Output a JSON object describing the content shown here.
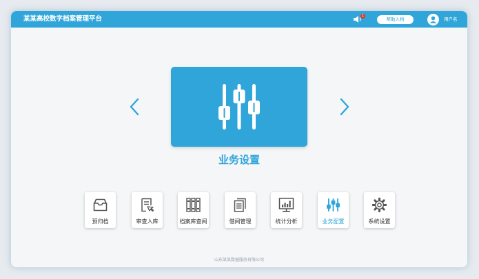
{
  "header": {
    "title": "某某高校数字档案管理平台",
    "notification_count": "1",
    "help_label": "帮助入档",
    "username": "用户名"
  },
  "feature": {
    "title": "业务设置",
    "icon": "sliders-icon"
  },
  "nav": [
    {
      "label": "预归档",
      "icon": "inbox-icon"
    },
    {
      "label": "审查入库",
      "icon": "document-review-icon"
    },
    {
      "label": "档案库查阅",
      "icon": "binders-icon"
    },
    {
      "label": "借阅管理",
      "icon": "documents-icon"
    },
    {
      "label": "统计分析",
      "icon": "bar-chart-icon"
    },
    {
      "label": "业务配置",
      "icon": "sliders-icon",
      "active": true
    },
    {
      "label": "系统设置",
      "icon": "gear-icon"
    }
  ],
  "footer": {
    "copyright": "山东某某数据服务有限公司"
  },
  "colors": {
    "accent": "#2fa5da",
    "background": "#f4f6f8",
    "badge": "#e23a2e"
  }
}
